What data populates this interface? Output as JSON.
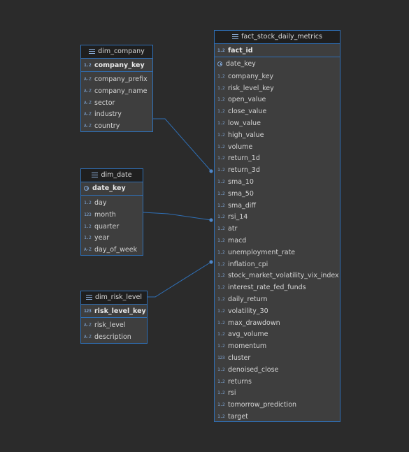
{
  "entities": {
    "dim_company": {
      "title": "dim_company",
      "pk": {
        "name": "company_key",
        "type": "123"
      },
      "columns": [
        {
          "name": "company_prefix",
          "type": "abc"
        },
        {
          "name": "company_name",
          "type": "abc"
        },
        {
          "name": "sector",
          "type": "abc"
        },
        {
          "name": "industry",
          "type": "abc"
        },
        {
          "name": "country",
          "type": "abc"
        }
      ]
    },
    "dim_date": {
      "title": "dim_date",
      "pk": {
        "name": "date_key",
        "type": "clock"
      },
      "columns": [
        {
          "name": "day",
          "type": "123"
        },
        {
          "name": "month",
          "type": "123b"
        },
        {
          "name": "quarter",
          "type": "123"
        },
        {
          "name": "year",
          "type": "123"
        },
        {
          "name": "day_of_week",
          "type": "abc"
        }
      ]
    },
    "dim_risk_level": {
      "title": "dim_risk_level",
      "pk": {
        "name": "risk_level_key",
        "type": "123b"
      },
      "columns": [
        {
          "name": "risk_level",
          "type": "abc"
        },
        {
          "name": "description",
          "type": "abc"
        }
      ]
    },
    "fact": {
      "title": "fact_stock_daily_metrics",
      "pk": {
        "name": "fact_id",
        "type": "123"
      },
      "columns": [
        {
          "name": "date_key",
          "type": "clock"
        },
        {
          "name": "company_key",
          "type": "123"
        },
        {
          "name": "risk_level_key",
          "type": "123"
        },
        {
          "name": "open_value",
          "type": "123"
        },
        {
          "name": "close_value",
          "type": "123"
        },
        {
          "name": "low_value",
          "type": "123"
        },
        {
          "name": "high_value",
          "type": "123"
        },
        {
          "name": "volume",
          "type": "123"
        },
        {
          "name": "return_1d",
          "type": "123"
        },
        {
          "name": "return_3d",
          "type": "123"
        },
        {
          "name": "sma_10",
          "type": "123"
        },
        {
          "name": "sma_50",
          "type": "123"
        },
        {
          "name": "sma_diff",
          "type": "123"
        },
        {
          "name": "rsi_14",
          "type": "123"
        },
        {
          "name": "atr",
          "type": "123"
        },
        {
          "name": "macd",
          "type": "123"
        },
        {
          "name": "unemployment_rate",
          "type": "123"
        },
        {
          "name": "inflation_cpi",
          "type": "123"
        },
        {
          "name": "stock_market_volatility_vix_index",
          "type": "123"
        },
        {
          "name": "interest_rate_fed_funds",
          "type": "123"
        },
        {
          "name": "daily_return",
          "type": "123"
        },
        {
          "name": "volatility_30",
          "type": "123"
        },
        {
          "name": "max_drawdown",
          "type": "123"
        },
        {
          "name": "avg_volume",
          "type": "123"
        },
        {
          "name": "momentum",
          "type": "123"
        },
        {
          "name": "cluster",
          "type": "123b"
        },
        {
          "name": "denoised_close",
          "type": "123"
        },
        {
          "name": "returns",
          "type": "123"
        },
        {
          "name": "rsi",
          "type": "123"
        },
        {
          "name": "tomorrow_prediction",
          "type": "123"
        },
        {
          "name": "target",
          "type": "123"
        }
      ]
    }
  },
  "type_glyphs": {
    "123": "1.2",
    "123b": "123",
    "abc": "A-Z",
    "clock": ""
  },
  "colors": {
    "background": "#2b2b2b",
    "entity_fill": "#3e3e3e",
    "entity_border": "#2f6fb5",
    "header_fill": "#1f1f1f",
    "connector": "#2f6fb5"
  }
}
